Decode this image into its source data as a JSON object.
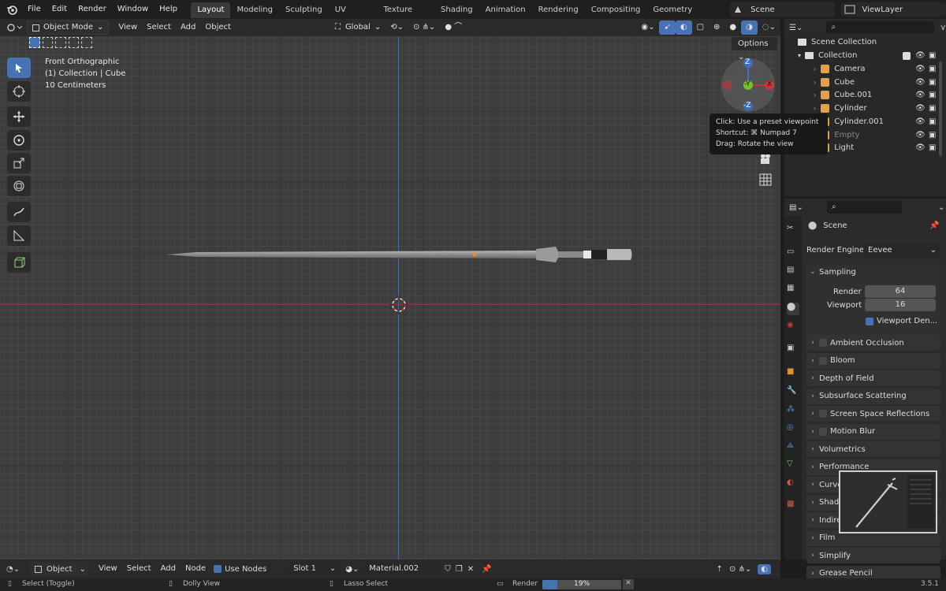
{
  "menu": [
    "File",
    "Edit",
    "Render",
    "Window",
    "Help"
  ],
  "workspaces": [
    "Layout",
    "Modeling",
    "Sculpting",
    "UV Editing",
    "Texture Paint",
    "Shading",
    "Animation",
    "Rendering",
    "Compositing",
    "Geometry Nodes"
  ],
  "active_workspace": "Layout",
  "scene_name": "Scene",
  "view_layer": "ViewLayer",
  "viewport_header": {
    "mode": "Object Mode",
    "menus": [
      "View",
      "Select",
      "Add",
      "Object"
    ],
    "orientation": "Global",
    "options": "Options"
  },
  "viewport_info": {
    "view": "Front Orthographic",
    "collection": "(1) Collection | Cube",
    "scale": "10 Centimeters"
  },
  "gizmo": {
    "z": "Z",
    "y": "-Y",
    "x": "X",
    "neg_z": "-Z"
  },
  "tooltip": [
    "Click: Use a preset viewpoint",
    "Shortcut: ⌘ Numpad 7",
    "Drag: Rotate the view"
  ],
  "outliner": {
    "scene_collection": "Scene Collection",
    "collection": "Collection",
    "items": [
      {
        "name": "Camera",
        "color": "#e2a14a"
      },
      {
        "name": "Cube",
        "color": "#e2a14a"
      },
      {
        "name": "Cube.001",
        "color": "#e2a14a"
      },
      {
        "name": "Cylinder",
        "color": "#e2a14a"
      },
      {
        "name": "Cylinder.001",
        "color": "#e2a14a"
      },
      {
        "name": "Empty",
        "color": "#e2a14a"
      },
      {
        "name": "Light",
        "color": "#e2a14a"
      }
    ]
  },
  "properties": {
    "title": "Scene",
    "render_engine_label": "Render Engine",
    "render_engine": "Eevee",
    "sampling": {
      "label": "Sampling",
      "render_label": "Render",
      "render": "64",
      "viewport_label": "Viewport",
      "viewport": "16",
      "denoise": "Viewport Den..."
    },
    "panels": [
      {
        "label": "Ambient Occlusion",
        "check": true
      },
      {
        "label": "Bloom",
        "check": true
      },
      {
        "label": "Depth of Field",
        "check": false
      },
      {
        "label": "Subsurface Scattering",
        "check": false
      },
      {
        "label": "Screen Space Reflections",
        "check": true
      },
      {
        "label": "Motion Blur",
        "check": true
      },
      {
        "label": "Volumetrics",
        "check": false
      },
      {
        "label": "Performance",
        "check": false
      },
      {
        "label": "Curves",
        "check": false
      },
      {
        "label": "Shadows",
        "check": false
      },
      {
        "label": "Indirect Lighting",
        "check": false
      },
      {
        "label": "Film",
        "check": false
      },
      {
        "label": "Simplify",
        "check": false
      },
      {
        "label": "Grease Pencil",
        "check": false
      }
    ]
  },
  "footer": {
    "editor": "Object",
    "menus": [
      "View",
      "Select",
      "Add",
      "Node"
    ],
    "use_nodes": "Use Nodes",
    "slot": "Slot 1",
    "material": "Material.002"
  },
  "status": {
    "select": "Select (Toggle)",
    "dolly": "Dolly View",
    "lasso": "Lasso Select",
    "render": "Render",
    "progress": "19%",
    "progress_value": 0.19,
    "version": "3.5.1"
  },
  "colors": {
    "accent": "#4772b3",
    "x_axis": "#c8353b",
    "y_axis": "#6ea72e",
    "z_axis": "#3b6fc8"
  }
}
